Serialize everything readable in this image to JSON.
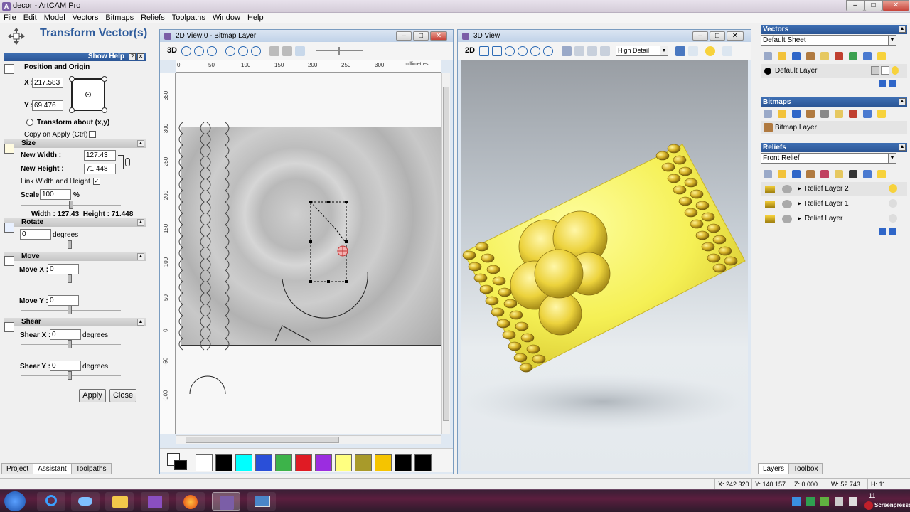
{
  "window": {
    "title": "decor - ArtCAM Pro",
    "min": "–",
    "max": "□",
    "close": "✕"
  },
  "menu": [
    "File",
    "Edit",
    "Model",
    "Vectors",
    "Bitmaps",
    "Reliefs",
    "Toolpaths",
    "Window",
    "Help"
  ],
  "left": {
    "title": "Transform Vector(s)",
    "show_help": "Show Help",
    "position_origin": "Position and Origin",
    "x_label": "X :",
    "x_value": "217.583",
    "y_label": "Y :",
    "y_value": "69.476",
    "transform_about": "Transform about (x,y)",
    "copy_on_apply": "Copy on Apply (Ctrl)",
    "size": {
      "header": "Size",
      "new_width_label": "New Width :",
      "new_width": "127.43",
      "new_height_label": "New Height :",
      "new_height": "71.448",
      "link_label": "Link Width and Height",
      "scale_label": "Scale",
      "scale_value": "100",
      "scale_unit": "%",
      "summary": "Width : 127.43  Height : 71.448"
    },
    "rotate": {
      "header": "Rotate",
      "value": "0",
      "unit": "degrees"
    },
    "move": {
      "header": "Move",
      "x_label": "Move X :",
      "x_value": "0",
      "y_label": "Move Y :",
      "y_value": "0"
    },
    "shear": {
      "header": "Shear",
      "x_label": "Shear X :",
      "x_value": "0",
      "x_unit": "degrees",
      "y_label": "Shear Y :",
      "y_value": "0",
      "y_unit": "degrees"
    },
    "apply": "Apply",
    "close": "Close",
    "tabs": [
      "Project",
      "Assistant",
      "Toolpaths"
    ]
  },
  "view2d": {
    "title": "2D View:0 - Bitmap Layer",
    "toggle": "3D",
    "ruler_h": [
      "0",
      "50",
      "100",
      "150",
      "200",
      "250",
      "300"
    ],
    "ruler_unit": "millimetres",
    "ruler_v": [
      "350",
      "300",
      "250",
      "200",
      "150",
      "100",
      "50",
      "0",
      "-50",
      "-100"
    ],
    "swatches": [
      "#ffffff",
      "#000000",
      "#00ffff",
      "#2a4fd8",
      "#3db34a",
      "#e01b24",
      "#9b2de0",
      "#ffff80",
      "#a89a2a",
      "#f5c400",
      "#000000",
      "#000000"
    ]
  },
  "view3d": {
    "title": "3D View",
    "toggle": "2D",
    "detail": "High Detail"
  },
  "right": {
    "vectors_header": "Vectors",
    "vectors_sheet": "Default Sheet",
    "vectors_layer": "Default Layer",
    "bitmaps_header": "Bitmaps",
    "bitmap_layer": "Bitmap Layer",
    "reliefs_header": "Reliefs",
    "reliefs_select": "Front Relief",
    "relief_layers": [
      "Relief Layer 2",
      "Relief Layer 1",
      "Relief Layer"
    ],
    "tabs": [
      "Layers",
      "Toolbox"
    ]
  },
  "status": {
    "x": "X: 242.320",
    "y": "Y: 140.157",
    "z": "Z: 0.000",
    "w": "W: 52.743",
    "h": "H: 11"
  },
  "taskbar": {
    "clock": "11",
    "watermark": "Screenpresso"
  }
}
